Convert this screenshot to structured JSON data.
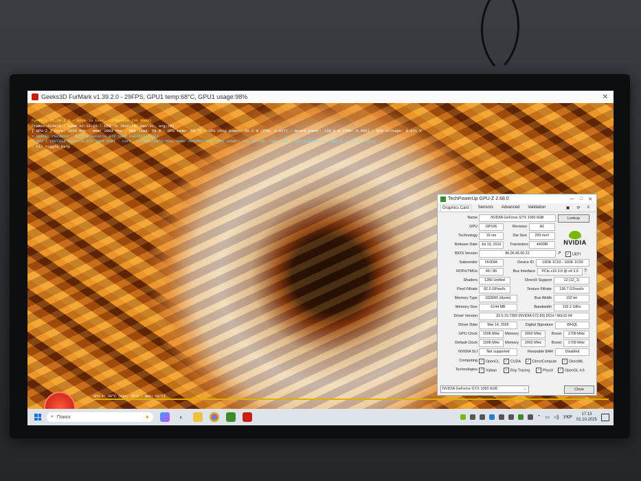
{
  "furmark": {
    "window_title": "Geeks3D FurMark v1.39.2.0 - 29FPS, GPU1 temp:68°C, GPU1 usage:98%",
    "hud_lines": [
      {
        "text": "FurMark v1.39.2.0 - Burn-in test, 1920x1080 (0X MSAA)",
        "color": "y"
      },
      {
        "text": "Frames:624916 - time:02:13:05 - FPS:79 (min:74, max:81, avg:78)",
        "color": "w"
      },
      {
        "text": "[ GPU-Z ] core: 1556 MHz - mem: 2003 MHz - GPU load: 98 % - GPU temp: 68 °C - GPU chip power: 86.2 W (PPW: 0.917) - Board power: 118.8 W (PPW: 0.665) - GPU voltage: 0.831 V",
        "color": "w"
      },
      {
        "text": "> OpenGL renderer: NVIDIA GeForce GTX 1060 6GB/PCIe/SSE2",
        "color": "c"
      },
      {
        "text": "> GPU 1 (NVIDIA GeForce GTX 1060 6GB) - core: 1531MHz/68°C/98%, mem: 4006MHz/11%, GPU power: 101.1% TDP, fan: 51%, limits(power:1, temp:0, volt:0, OV:0)",
        "color": "c"
      },
      {
        "text": "- F1: toggle help",
        "color": "w"
      }
    ],
    "graph_label": "GPU 1: 68°C (min: 39°C - max: 68°C)"
  },
  "gpuz": {
    "title": "TechPowerUp GPU-Z 2.68.0",
    "tabs": [
      "Graphics Card",
      "Sensors",
      "Advanced",
      "Validation"
    ],
    "lookup_label": "Lookup",
    "uefi_label": "UEFI",
    "uefi_checked": true,
    "rows": {
      "name": {
        "label": "Name",
        "value": "NVIDIA GeForce GTX 1060 6GB"
      },
      "gpu": {
        "label": "GPU",
        "value": "GP106"
      },
      "revision": {
        "label": "Revision",
        "value": "A1"
      },
      "technology": {
        "label": "Technology",
        "value": "16 nm"
      },
      "die_size": {
        "label": "Die Size",
        "value": "200 mm²"
      },
      "release_date": {
        "label": "Release Date",
        "value": "Jul 19, 2016"
      },
      "transistors": {
        "label": "Transistors",
        "value": "4400M"
      },
      "bios_version": {
        "label": "BIOS Version",
        "value": "86.06.45.00.22"
      },
      "subvendor": {
        "label": "Subvendor",
        "value": "NVIDIA"
      },
      "device_id": {
        "label": "Device ID",
        "value": "10DE 1C03 - 10DE 1C03"
      },
      "rops_tmus": {
        "label": "ROPs/TMUs",
        "value": "48 / 80"
      },
      "bus_interface": {
        "label": "Bus Interface",
        "value": "PCIe x16 3.0 @ x4 3.0"
      },
      "shaders": {
        "label": "Shaders",
        "value": "1280 Unified"
      },
      "directx": {
        "label": "DirectX Support",
        "value": "12 (12_1)"
      },
      "pixel_fillrate": {
        "label": "Pixel Fillrate",
        "value": "82.0 GPixel/s"
      },
      "texture_fillrate": {
        "label": "Texture Fillrate",
        "value": "136.7 GTexel/s"
      },
      "memory_type": {
        "label": "Memory Type",
        "value": "GDDR5 (Hynix)"
      },
      "bus_width": {
        "label": "Bus Width",
        "value": "192 bit"
      },
      "memory_size": {
        "label": "Memory Size",
        "value": "6144 MB"
      },
      "bandwidth": {
        "label": "Bandwidth",
        "value": "192.2 GB/s"
      },
      "driver_version": {
        "label": "Driver Version",
        "value": "32.0.15.7283 (NVIDIA 572.83) DCH / Win10 64"
      },
      "driver_date": {
        "label": "Driver Date",
        "value": "Mar 14, 2025"
      },
      "digital_signature": {
        "label": "Digital Signature",
        "value": "WHQL"
      },
      "gpu_clock": {
        "label": "GPU Clock",
        "value": "1506 MHz",
        "memory": "2002 MHz",
        "boost": "1709 MHz"
      },
      "default_clock": {
        "label": "Default Clock",
        "value": "1506 MHz",
        "memory": "2002 MHz",
        "boost": "1709 MHz"
      },
      "sli": {
        "label": "NVIDIA SLI",
        "value": "Not supported"
      },
      "resizable_bar": {
        "label": "Resizable BAR",
        "value": "Disabled"
      },
      "memory_label": "Memory",
      "boost_label": "Boost"
    },
    "computing_label": "Computing",
    "computing": [
      "OpenCL",
      "CUDA",
      "DirectCompute",
      "DirectML"
    ],
    "technologies_label": "Technologies",
    "technologies": [
      "Vulkan",
      "Ray Tracing",
      "PhysX",
      "OpenGL 4.6"
    ],
    "selected_gpu": "NVIDIA GeForce GTX 1060 6GB",
    "close_label": "Close",
    "logo_text": "NVIDIA"
  },
  "taskbar": {
    "search_placeholder": "Поиск",
    "language": "УКР",
    "time": "17:13",
    "date": "01.10.2025"
  },
  "colors": {
    "nvidia_green": "#76b900",
    "taskbar": "#dfe3ea"
  }
}
